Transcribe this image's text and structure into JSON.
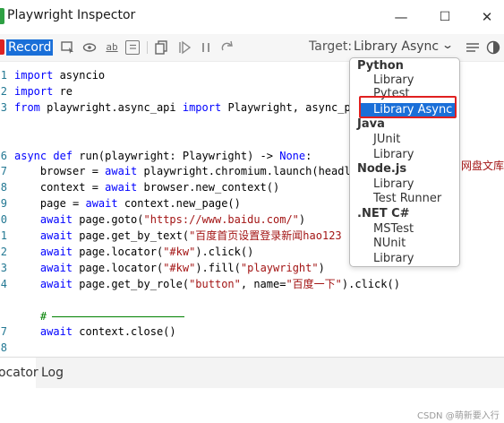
{
  "window": {
    "title": "Playwright Inspector",
    "controls": {
      "minimize": "—",
      "maximize": "☐",
      "close": "✕"
    }
  },
  "toolbar": {
    "record_label": "Record",
    "target_label": "Target:",
    "target_value": "Library Async"
  },
  "editor": {
    "lines": [
      {
        "n": "1",
        "tokens": [
          {
            "t": "import",
            "c": "k"
          },
          {
            "t": " asyncio",
            "c": "t"
          }
        ]
      },
      {
        "n": "2",
        "tokens": [
          {
            "t": "import",
            "c": "k"
          },
          {
            "t": " re",
            "c": "t"
          }
        ]
      },
      {
        "n": "3",
        "tokens": [
          {
            "t": "from",
            "c": "k"
          },
          {
            "t": " playwright.async_api ",
            "c": "t"
          },
          {
            "t": "import",
            "c": "k"
          },
          {
            "t": " Playwright, async_pla",
            "c": "t"
          }
        ]
      },
      {
        "n": "",
        "tokens": []
      },
      {
        "n": "",
        "tokens": []
      },
      {
        "n": "6",
        "tokens": [
          {
            "t": "async def",
            "c": "k"
          },
          {
            "t": " run(playwright: Playwright) -> ",
            "c": "t"
          },
          {
            "t": "None",
            "c": "k"
          },
          {
            "t": ":",
            "c": "t"
          }
        ]
      },
      {
        "n": "7",
        "tokens": [
          {
            "t": "    browser = ",
            "c": "t"
          },
          {
            "t": "await",
            "c": "k"
          },
          {
            "t": " playwright.chromium.launch(headles",
            "c": "t"
          }
        ]
      },
      {
        "n": "8",
        "tokens": [
          {
            "t": "    context = ",
            "c": "t"
          },
          {
            "t": "await",
            "c": "k"
          },
          {
            "t": " browser.new_context()",
            "c": "t"
          }
        ]
      },
      {
        "n": "9",
        "tokens": [
          {
            "t": "    page = ",
            "c": "t"
          },
          {
            "t": "await",
            "c": "k"
          },
          {
            "t": " context.new_page()",
            "c": "t"
          }
        ]
      },
      {
        "n": "0",
        "tokens": [
          {
            "t": "    ",
            "c": "t"
          },
          {
            "t": "await",
            "c": "k"
          },
          {
            "t": " page.goto(",
            "c": "t"
          },
          {
            "t": "\"https://www.baidu.com/\"",
            "c": "s"
          },
          {
            "t": ")",
            "c": "t"
          }
        ]
      },
      {
        "n": "1",
        "tokens": [
          {
            "t": "    ",
            "c": "t"
          },
          {
            "t": "await",
            "c": "k"
          },
          {
            "t": " page.get_by_text(",
            "c": "t"
          },
          {
            "t": "\"百度首页设置登录新闻hao123",
            "c": "s"
          }
        ]
      },
      {
        "n": "2",
        "tokens": [
          {
            "t": "    ",
            "c": "t"
          },
          {
            "t": "await",
            "c": "k"
          },
          {
            "t": " page.locator(",
            "c": "t"
          },
          {
            "t": "\"#kw\"",
            "c": "s"
          },
          {
            "t": ").click()",
            "c": "t"
          }
        ]
      },
      {
        "n": "3",
        "tokens": [
          {
            "t": "    ",
            "c": "t"
          },
          {
            "t": "await",
            "c": "k"
          },
          {
            "t": " page.locator(",
            "c": "t"
          },
          {
            "t": "\"#kw\"",
            "c": "s"
          },
          {
            "t": ").fill(",
            "c": "t"
          },
          {
            "t": "\"playwright\"",
            "c": "s"
          },
          {
            "t": ")",
            "c": "t"
          }
        ]
      },
      {
        "n": "4",
        "tokens": [
          {
            "t": "    ",
            "c": "t"
          },
          {
            "t": "await",
            "c": "k"
          },
          {
            "t": " page.get_by_role(",
            "c": "t"
          },
          {
            "t": "\"button\"",
            "c": "s"
          },
          {
            "t": ", name=",
            "c": "t"
          },
          {
            "t": "\"百度一下\"",
            "c": "s"
          },
          {
            "t": ").click()",
            "c": "t"
          }
        ]
      },
      {
        "n": "",
        "tokens": []
      },
      {
        "n": "",
        "tokens": [
          {
            "t": "    # ",
            "c": "c"
          }
        ]
      },
      {
        "n": "7",
        "tokens": [
          {
            "t": "    ",
            "c": "t"
          },
          {
            "t": "await",
            "c": "k"
          },
          {
            "t": " context.close()",
            "c": "t"
          }
        ]
      },
      {
        "n": "8",
        "tokens": []
      }
    ],
    "hidden_tail": "网盘文库"
  },
  "dropdown": {
    "groups": [
      {
        "label": "Python",
        "options": [
          "Library",
          "Pytest",
          "Library Async"
        ]
      },
      {
        "label": "Java",
        "options": [
          "JUnit",
          "Library"
        ]
      },
      {
        "label": "Node.js",
        "options": [
          "Library",
          "Test Runner"
        ]
      },
      {
        "label": ".NET C#",
        "options": [
          "MSTest",
          "NUnit",
          "Library"
        ]
      }
    ],
    "selected": "Library Async"
  },
  "panel_tabs": {
    "locator": "ocator",
    "log": "Log"
  },
  "watermark": "CSDN @萌新要入行",
  "colors": {
    "record": "#1a6fd8",
    "highlight_box": "#e02020",
    "keyword": "#0000ff",
    "string": "#a31515",
    "comment": "#008000"
  }
}
